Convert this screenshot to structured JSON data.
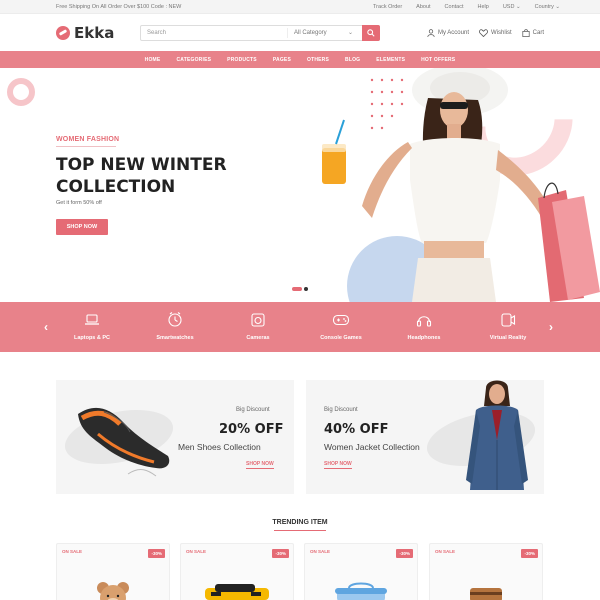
{
  "topbar": {
    "promo": "Free Shipping On All Order Over $100 Code : NEW",
    "links": [
      "Track Order",
      "About",
      "Contact",
      "Help",
      "USD",
      "Country"
    ]
  },
  "header": {
    "logo": "Ekka",
    "search_placeholder": "Search",
    "category_select": "All Category",
    "account": "My Account",
    "wishlist": "Wishlist",
    "cart": "Cart"
  },
  "nav": {
    "items": [
      "HOME",
      "CATEGORIES",
      "PRODUCTS",
      "PAGES",
      "OTHERS",
      "BLOG",
      "ELEMENTS",
      "HOT OFFERS"
    ]
  },
  "hero": {
    "eyebrow": "WOMEN FASHION",
    "title_line1": "TOP NEW WINTER",
    "title_line2": "COLLECTION",
    "subtitle": "Get it form 50% off",
    "cta": "SHOP NOW"
  },
  "categories": {
    "items": [
      {
        "label": "Laptops & PC",
        "icon": "laptop-icon"
      },
      {
        "label": "Smartwatches",
        "icon": "watch-icon"
      },
      {
        "label": "Cameras",
        "icon": "camera-icon"
      },
      {
        "label": "Console Games",
        "icon": "gamepad-icon"
      },
      {
        "label": "Headphones",
        "icon": "headphones-icon"
      },
      {
        "label": "Virtual Reality",
        "icon": "vr-icon"
      }
    ]
  },
  "banners": [
    {
      "eyebrow": "Big Discount",
      "offer": "20% OFF",
      "description": "Men Shoes Collection",
      "cta": "SHOP NOW"
    },
    {
      "eyebrow": "Big Discount",
      "offer": "40% OFF",
      "description": "Women Jacket Collection",
      "cta": "SHOP NOW"
    }
  ],
  "trending": {
    "title": "TRENDING ITEM",
    "cards": [
      {
        "badge": "ON SALE",
        "discount": "-30%"
      },
      {
        "badge": "ON SALE",
        "discount": "-30%"
      },
      {
        "badge": "ON SALE",
        "discount": "-30%"
      },
      {
        "badge": "ON SALE",
        "discount": "-30%"
      }
    ]
  },
  "colors": {
    "accent": "#e56b75",
    "nav": "#e8828a"
  }
}
